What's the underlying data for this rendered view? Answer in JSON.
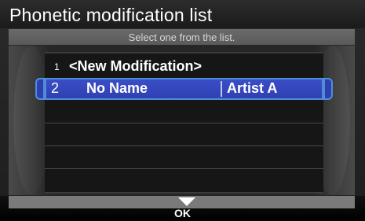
{
  "header": {
    "title": "Phonetic modification list"
  },
  "instruction": "Select one from the list.",
  "list": {
    "items": [
      {
        "number": "1",
        "label": "<New Modification>"
      },
      {
        "number": "2",
        "name": "No Name",
        "artist": "Artist A",
        "selected": true
      }
    ]
  },
  "footer": {
    "ok_label": "OK",
    "ok_icon": "chevron-down-icon"
  },
  "colors": {
    "selection": "#2f3fb0",
    "selection_border": "#4d8fd6",
    "background": "#1e1e1e"
  }
}
